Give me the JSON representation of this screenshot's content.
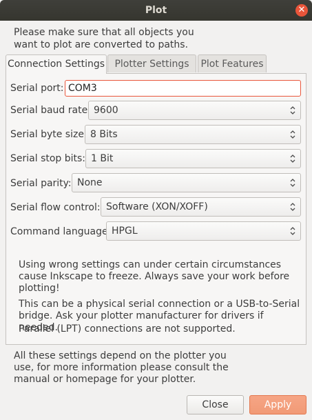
{
  "window": {
    "title": "Plot"
  },
  "intro": "Please make sure that all objects you want to plot are converted to paths.",
  "tabs": [
    {
      "label": "Connection Settings",
      "active": true
    },
    {
      "label": "Plotter Settings",
      "active": false
    },
    {
      "label": "Plot Features",
      "active": false
    }
  ],
  "fields": {
    "serial_port": {
      "label": "Serial port:",
      "value": "COM3"
    },
    "baud_rate": {
      "label": "Serial baud rate:",
      "value": "9600"
    },
    "byte_size": {
      "label": "Serial byte size:",
      "value": "8 Bits"
    },
    "stop_bits": {
      "label": "Serial stop bits:",
      "value": "1 Bit"
    },
    "parity": {
      "label": "Serial parity:",
      "value": "None"
    },
    "flow_control": {
      "label": "Serial flow control:",
      "value": "Software (XON/XOFF)"
    },
    "command_language": {
      "label": "Command language:",
      "value": "HPGL"
    }
  },
  "notes": {
    "warning": "Using wrong settings can under certain circumstances cause Inkscape to freeze. Always save your work before plotting!",
    "connection": "This can be a physical serial connection or a USB-to-Serial bridge. Ask your plotter manufacturer for drivers if needed.",
    "parallel": "Parallel (LPT) connections are not supported."
  },
  "footer_note": "All these settings depend on the plotter you use, for more information please consult the manual or homepage for your plotter.",
  "buttons": {
    "close": "Close",
    "apply": "Apply"
  },
  "colors": {
    "accent": "#e9553a",
    "titlebar": "#3c3b37",
    "apply": "#f19a76"
  }
}
